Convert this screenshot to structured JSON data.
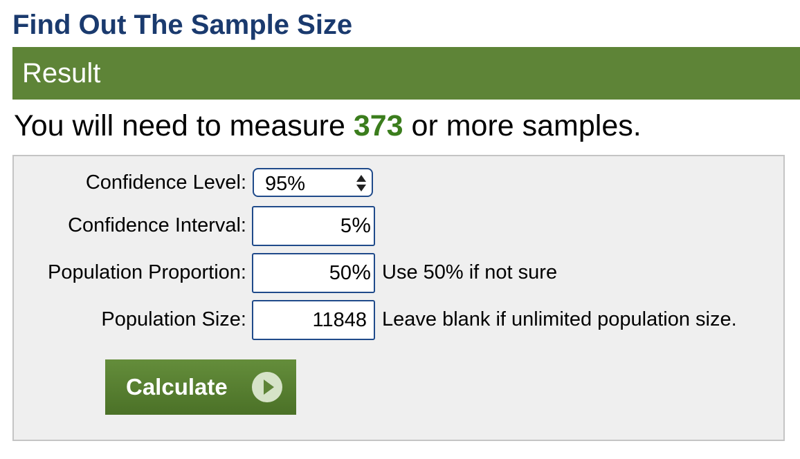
{
  "page": {
    "title": "Find Out The Sample Size"
  },
  "result": {
    "heading": "Result",
    "prefix": "You will need to measure ",
    "sample_count": "373",
    "suffix": " or more samples."
  },
  "form": {
    "confidence_level": {
      "label": "Confidence Level:",
      "value": "95%"
    },
    "confidence_interval": {
      "label": "Confidence Interval:",
      "value": "5",
      "unit": "%"
    },
    "population_proportion": {
      "label": "Population Proportion:",
      "value": "50",
      "unit": "%",
      "hint": "Use 50% if not sure"
    },
    "population_size": {
      "label": "Population Size:",
      "value": "11848",
      "hint": "Leave blank if unlimited population size."
    },
    "calculate_label": "Calculate"
  },
  "colors": {
    "title": "#1a3a6e",
    "result_bar": "#5e8437",
    "result_number": "#3b7d1d",
    "field_border": "#1f4a8a",
    "panel_background": "#efefef"
  },
  "icons": {
    "select": "chevron-up-down-icon",
    "button": "play-circle-icon"
  }
}
